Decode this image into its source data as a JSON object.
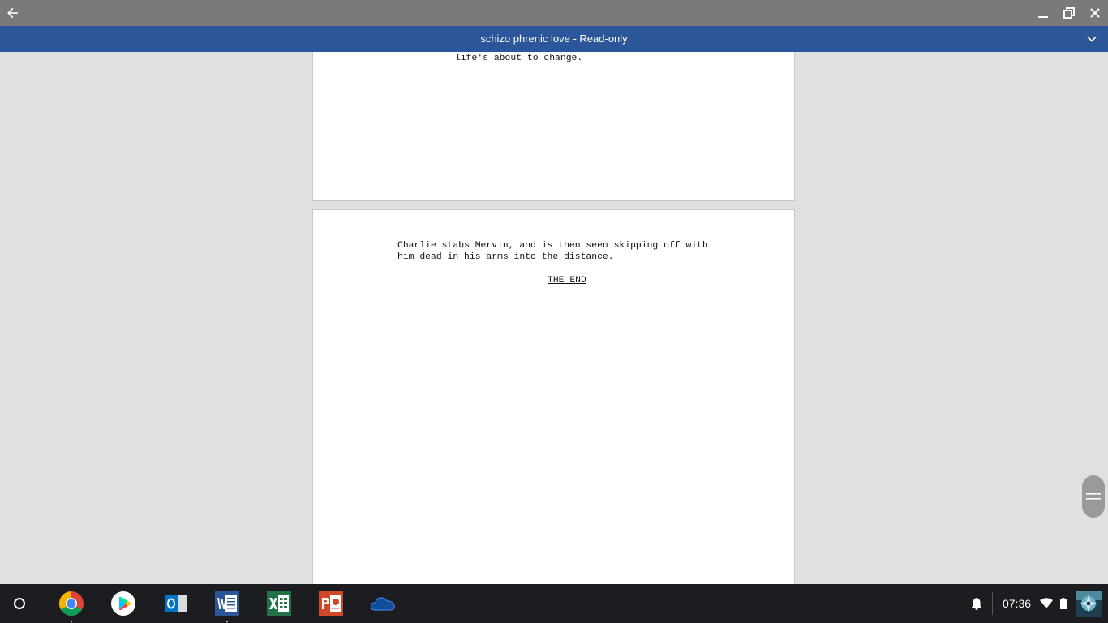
{
  "window": {
    "back_icon": "arrow-left-icon",
    "minimize_icon": "minimize-icon",
    "restore_icon": "restore-icon",
    "close_icon": "close-icon"
  },
  "titlebar": {
    "title": "schizo phrenic love - Read-only",
    "menu_icon": "chevron-down-icon",
    "accent": "#2b579a"
  },
  "document": {
    "pages": [
      {
        "lines": [
          "life's about to change."
        ]
      },
      {
        "action": "Charlie stabs Mervin, and is then seen skipping off with\nhim dead in his arms into the distance.",
        "transition": "THE END"
      }
    ]
  },
  "scroll_handle": {
    "icon": "drag-handle-icon"
  },
  "shelf": {
    "launcher_icon": "launcher-circle-icon",
    "apps": [
      {
        "name": "Chrome",
        "icon": "chrome-icon",
        "running": true
      },
      {
        "name": "Play Store",
        "icon": "play-store-icon",
        "running": false
      },
      {
        "name": "Outlook",
        "icon": "outlook-icon",
        "running": false
      },
      {
        "name": "Word",
        "icon": "word-icon",
        "running": true
      },
      {
        "name": "Excel",
        "icon": "excel-icon",
        "running": false
      },
      {
        "name": "PowerPoint",
        "icon": "powerpoint-icon",
        "running": false
      },
      {
        "name": "OneDrive",
        "icon": "onedrive-icon",
        "running": false
      }
    ],
    "tray": {
      "notification_icon": "bell-icon",
      "time": "07:36",
      "wifi_icon": "wifi-icon",
      "battery_icon": "battery-icon",
      "avatar_icon": "user-avatar-icon"
    }
  }
}
